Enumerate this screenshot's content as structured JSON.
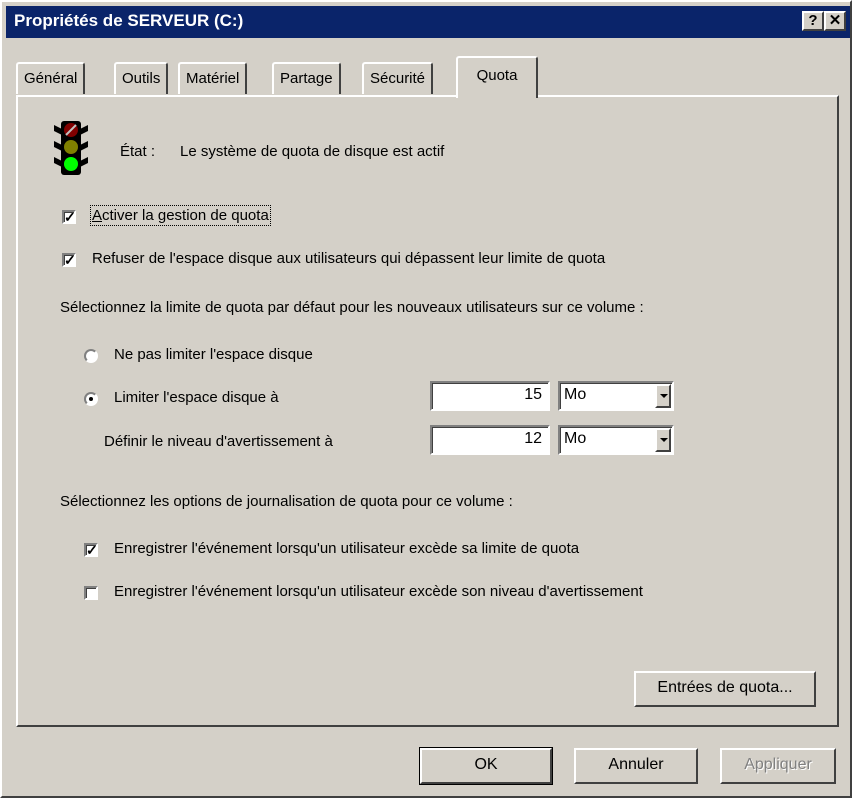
{
  "window": {
    "title": "Propriétés de SERVEUR (C:)",
    "help_btn": "?",
    "close_btn": "✕"
  },
  "tabs": [
    {
      "label": "Général"
    },
    {
      "label": "Outils"
    },
    {
      "label": "Matériel"
    },
    {
      "label": "Partage"
    },
    {
      "label": "Sécurité"
    },
    {
      "label": "Quota",
      "active": true
    }
  ],
  "status": {
    "label": "État :",
    "text": "Le système de quota de disque est actif",
    "icon": "traffic-light-icon"
  },
  "options": {
    "enable_quota": {
      "label": "Activer la gestion de quota",
      "checked": true
    },
    "deny_space": {
      "label": "Refuser de l'espace disque aux utilisateurs qui dépassent leur limite de quota",
      "checked": true
    }
  },
  "default_limit": {
    "heading": "Sélectionnez la limite de quota par défaut pour les nouveaux utilisateurs sur ce volume :",
    "no_limit_label": "Ne pas limiter l'espace disque",
    "limit_label": "Limiter l'espace disque à",
    "limit_value": "15",
    "limit_unit": "Mo",
    "warning_label": "Définir le niveau d'avertissement à",
    "warning_value": "12",
    "warning_unit": "Mo",
    "selected": "limit"
  },
  "logging": {
    "heading": "Sélectionnez les options de journalisation de quota pour ce volume :",
    "log_limit": {
      "label": "Enregistrer l'événement lorsqu'un utilisateur excède sa limite de quota",
      "checked": true
    },
    "log_warning": {
      "label": "Enregistrer l'événement lorsqu'un utilisateur excède son niveau d'avertissement",
      "checked": false
    }
  },
  "buttons": {
    "quota_entries": "Entrées de quota...",
    "ok": "OK",
    "cancel": "Annuler",
    "apply": "Appliquer"
  },
  "colors": {
    "titlebar": "#0a246a",
    "face": "#d4d0c8"
  }
}
